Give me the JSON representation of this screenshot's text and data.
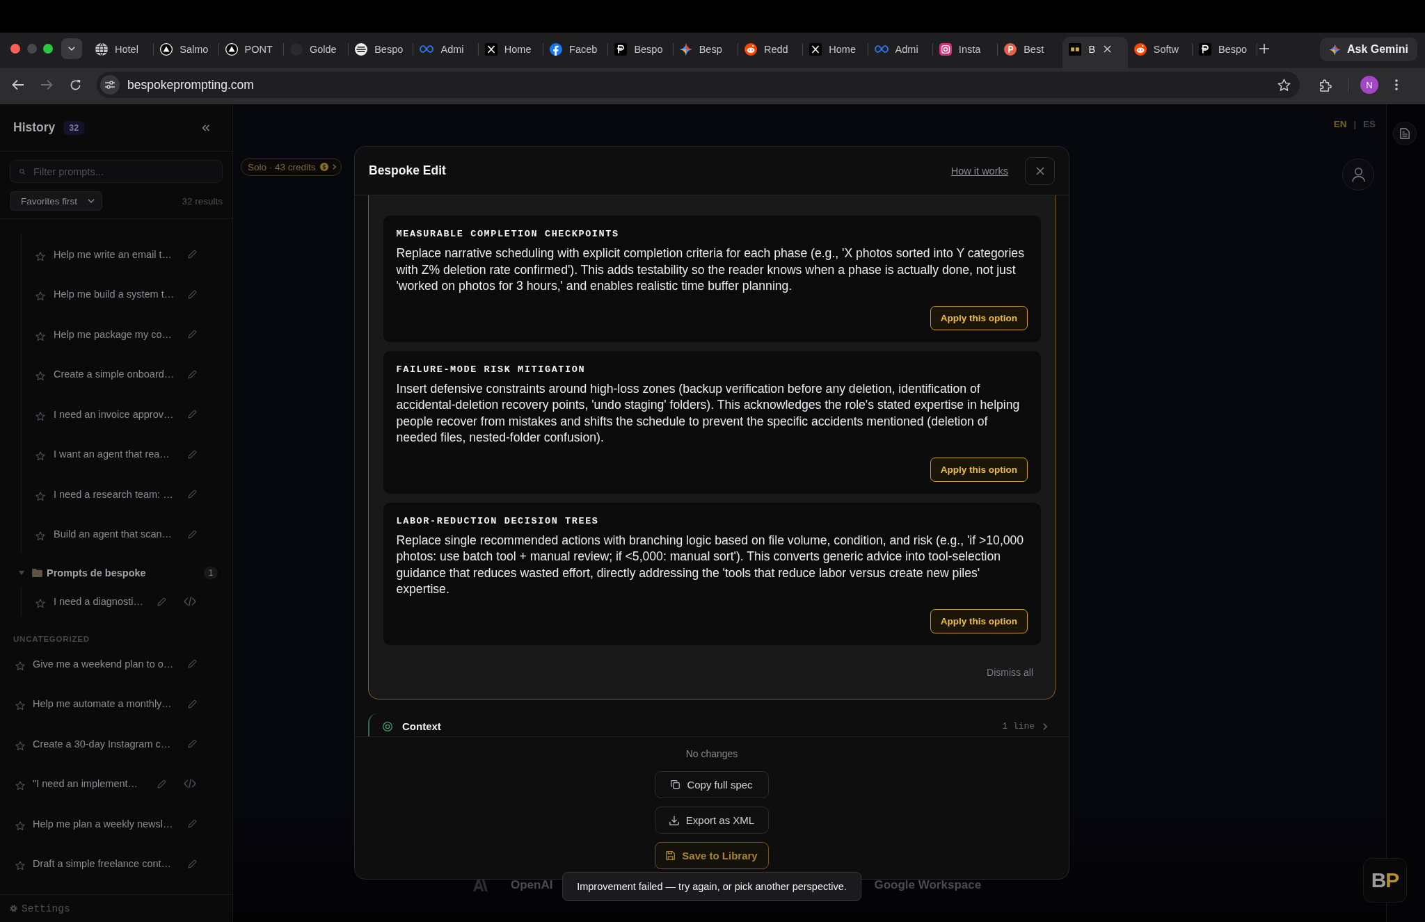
{
  "browser": {
    "tabs": [
      {
        "label": "Hotel",
        "kind": "globe",
        "selected": false
      },
      {
        "label": "Salmo",
        "kind": "triangle",
        "selected": false
      },
      {
        "label": "PONT",
        "kind": "triangle",
        "selected": false
      },
      {
        "label": "Golde",
        "kind": "circle",
        "selected": false
      },
      {
        "label": "Bespo",
        "kind": "stripes",
        "selected": false
      },
      {
        "label": "Admi",
        "kind": "infinity",
        "selected": false
      },
      {
        "label": "Home",
        "kind": "x",
        "selected": false
      },
      {
        "label": "Faceb",
        "kind": "f",
        "selected": false
      },
      {
        "label": "Bespo",
        "kind": "p",
        "selected": false
      },
      {
        "label": "Besp",
        "kind": "sparkle",
        "selected": false
      },
      {
        "label": "Redd",
        "kind": "face",
        "selected": false
      },
      {
        "label": "Home",
        "kind": "x",
        "selected": false
      },
      {
        "label": "Admi",
        "kind": "infinity",
        "selected": false
      },
      {
        "label": "Insta",
        "kind": "camera",
        "selected": false
      },
      {
        "label": "Best",
        "kind": "pcircle",
        "selected": false
      },
      {
        "label": "B",
        "kind": "square",
        "selected": true
      },
      {
        "label": "Softw",
        "kind": "face",
        "selected": false
      },
      {
        "label": "Bespo",
        "kind": "p",
        "selected": false
      }
    ],
    "gemini_button": "Ask Gemini",
    "url": "bespokeprompting.com",
    "profile_initial": "N"
  },
  "sidebar": {
    "title": "History",
    "count": "32",
    "filter_placeholder": "Filter prompts...",
    "sort": "Favorites first",
    "results": "32 results",
    "groups": [
      {
        "items": [
          {
            "label": "Help me write an email t…",
            "favorite": false,
            "code": false
          },
          {
            "label": "Help me build a system t…",
            "favorite": false,
            "code": false
          },
          {
            "label": "Help me package my co…",
            "favorite": false,
            "code": false
          },
          {
            "label": "Create a simple onboard…",
            "favorite": false,
            "code": false
          },
          {
            "label": "I need an invoice approv…",
            "favorite": false,
            "code": false
          },
          {
            "label": "I want an agent that rea…",
            "favorite": false,
            "code": false
          },
          {
            "label": "I need a research team: …",
            "favorite": false,
            "code": false
          },
          {
            "label": "Build an agent that scan…",
            "favorite": false,
            "code": false
          }
        ]
      },
      {
        "title": "Prompts de bespoke",
        "count": "1",
        "expanded": true,
        "items": [
          {
            "label": "I need a diagnosti…",
            "favorite": false,
            "code": true
          }
        ]
      }
    ],
    "uncategorized": {
      "heading": "UNCATEGORIZED",
      "items": [
        {
          "label": "Give me a weekend plan to o…",
          "favorite": false,
          "code": false
        },
        {
          "label": "Help me automate a monthly…",
          "favorite": false,
          "code": false
        },
        {
          "label": "Create a 30-day Instagram c…",
          "favorite": false,
          "code": false
        },
        {
          "label": "\"I need an implement…",
          "favorite": false,
          "code": true
        },
        {
          "label": "Help me plan a weekly newsl…",
          "favorite": false,
          "code": false
        },
        {
          "label": "Draft a simple freelance cont…",
          "favorite": false,
          "code": false
        }
      ]
    },
    "settings": "Settings"
  },
  "header": {
    "credits": "Solo · 43 credits",
    "languages": [
      {
        "label": "EN",
        "selected": true
      },
      {
        "label": "ES",
        "selected": false
      }
    ],
    "separator": "|"
  },
  "modal": {
    "title": "Bespoke Edit",
    "help_link": "How it works",
    "options": [
      {
        "title": "MEASURABLE COMPLETION CHECKPOINTS",
        "description": "Replace narrative scheduling with explicit completion criteria for each phase (e.g., 'X photos sorted into Y categories with Z% deletion rate confirmed'). This adds testability so the reader knows when a phase is actually done, not just 'worked on photos for 3 hours,' and enables realistic time buffer planning.",
        "button": "Apply this option"
      },
      {
        "title": "FAILURE-MODE RISK MITIGATION",
        "description": "Insert defensive constraints around high-loss zones (backup verification before any deletion, identification of accidental-deletion recovery points, 'undo staging' folders). This acknowledges the role's stated expertise in helping people recover from mistakes and shifts the schedule to prevent the specific accidents mentioned (deletion of needed files, nested-folder confusion).",
        "button": "Apply this option"
      },
      {
        "title": "LABOR-REDUCTION DECISION TREES",
        "description": "Replace single recommended actions with branching logic based on file volume, condition, and risk (e.g., 'if >10,000 photos: use batch tool + manual review; if <5,000: manual sort'). This converts generic advice into tool-selection guidance that reduces wasted effort, directly addressing the 'tools that reduce labor versus create new piles' expertise.",
        "button": "Apply this option"
      }
    ],
    "dismiss": "Dismiss all",
    "section": {
      "title": "Context",
      "meta": "1 line"
    },
    "status": "No changes",
    "actions": [
      {
        "label": "Copy full spec",
        "kind": "copy"
      },
      {
        "label": "Export as XML",
        "kind": "export"
      },
      {
        "label": "Save to Library",
        "kind": "save"
      }
    ]
  },
  "logos": [
    {
      "kind": "mark"
    },
    {
      "kind": "text",
      "label": "OpenAI"
    },
    {
      "kind": "text",
      "label": "Google Workspace"
    }
  ],
  "toast": "Improvement failed — try again, or pick another perspective.",
  "brand_logo": [
    "B",
    "P"
  ]
}
